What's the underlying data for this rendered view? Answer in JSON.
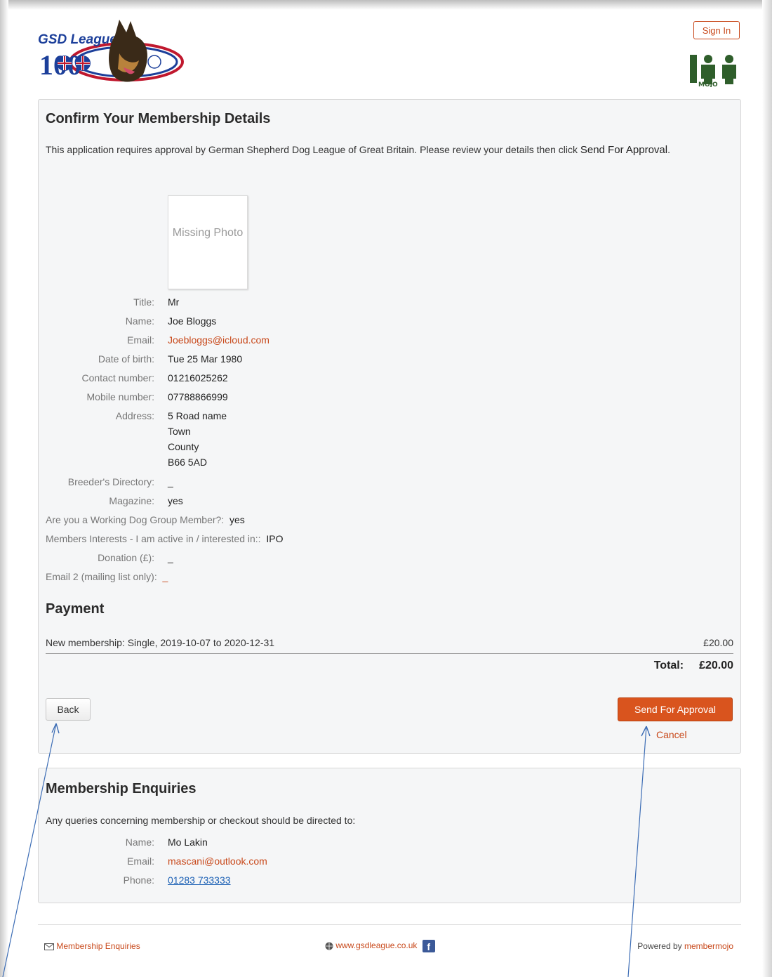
{
  "header": {
    "logo_text": "GSD League",
    "logo_number": "100",
    "signin_label": "Sign In",
    "mojo_logo_text": "member MOJO"
  },
  "confirm": {
    "title": "Confirm Your Membership Details",
    "intro_text": "This application requires approval by German Shepherd Dog League of Great Britain. Please review your details then click ",
    "intro_emph": "Send For Approval",
    "intro_end": ".",
    "photo_text": "Missing Photo",
    "fields": {
      "title": {
        "label": "Title:",
        "value": "Mr"
      },
      "name": {
        "label": "Name:",
        "value": "Joe Bloggs"
      },
      "email": {
        "label": "Email:",
        "value": "Joebloggs@icloud.com"
      },
      "dob": {
        "label": "Date of birth:",
        "value": "Tue 25 Mar 1980"
      },
      "contact": {
        "label": "Contact number:",
        "value": "01216025262"
      },
      "mobile": {
        "label": "Mobile number:",
        "value": "07788866999"
      },
      "address": {
        "label": "Address:",
        "lines": [
          "5 Road name",
          "Town",
          "County",
          "B66 5AD"
        ]
      },
      "breeder": {
        "label": "Breeder's Directory:",
        "value": "_"
      },
      "magazine": {
        "label": "Magazine:",
        "value": "yes"
      },
      "working": {
        "label": "Are you a Working Dog Group Member?:",
        "value": "yes"
      },
      "interests": {
        "label": "Members Interests - I am active in / interested in::",
        "value": "IPO"
      },
      "donation": {
        "label": "Donation (£):",
        "value": "_"
      },
      "email2": {
        "label": "Email 2 (mailing list only):",
        "value": "_"
      }
    }
  },
  "payment": {
    "title": "Payment",
    "line": "New membership: Single, 2019-10-07 to 2020-12-31",
    "line_amount": "£20.00",
    "total_label": "Total:",
    "total_amount": "£20.00"
  },
  "actions": {
    "back_label": "Back",
    "send_label": "Send For Approval",
    "cancel_label": "Cancel"
  },
  "enquiries": {
    "title": "Membership Enquiries",
    "text": "Any queries concerning membership or checkout should be directed to:",
    "name_label": "Name:",
    "name": "Mo Lakin",
    "email_label": "Email:",
    "email": "mascani@outlook.com",
    "phone_label": "Phone:",
    "phone": "01283 733333"
  },
  "footer": {
    "enquiries_link": "Membership Enquiries",
    "website_link": "www.gsdleague.co.uk",
    "powered_by": "Powered by ",
    "powered_link": "membermojo"
  },
  "colors": {
    "accent": "#d9541e",
    "link": "#c8481a",
    "panel_bg": "#f5f6f7",
    "arrow": "#3d6db5"
  }
}
